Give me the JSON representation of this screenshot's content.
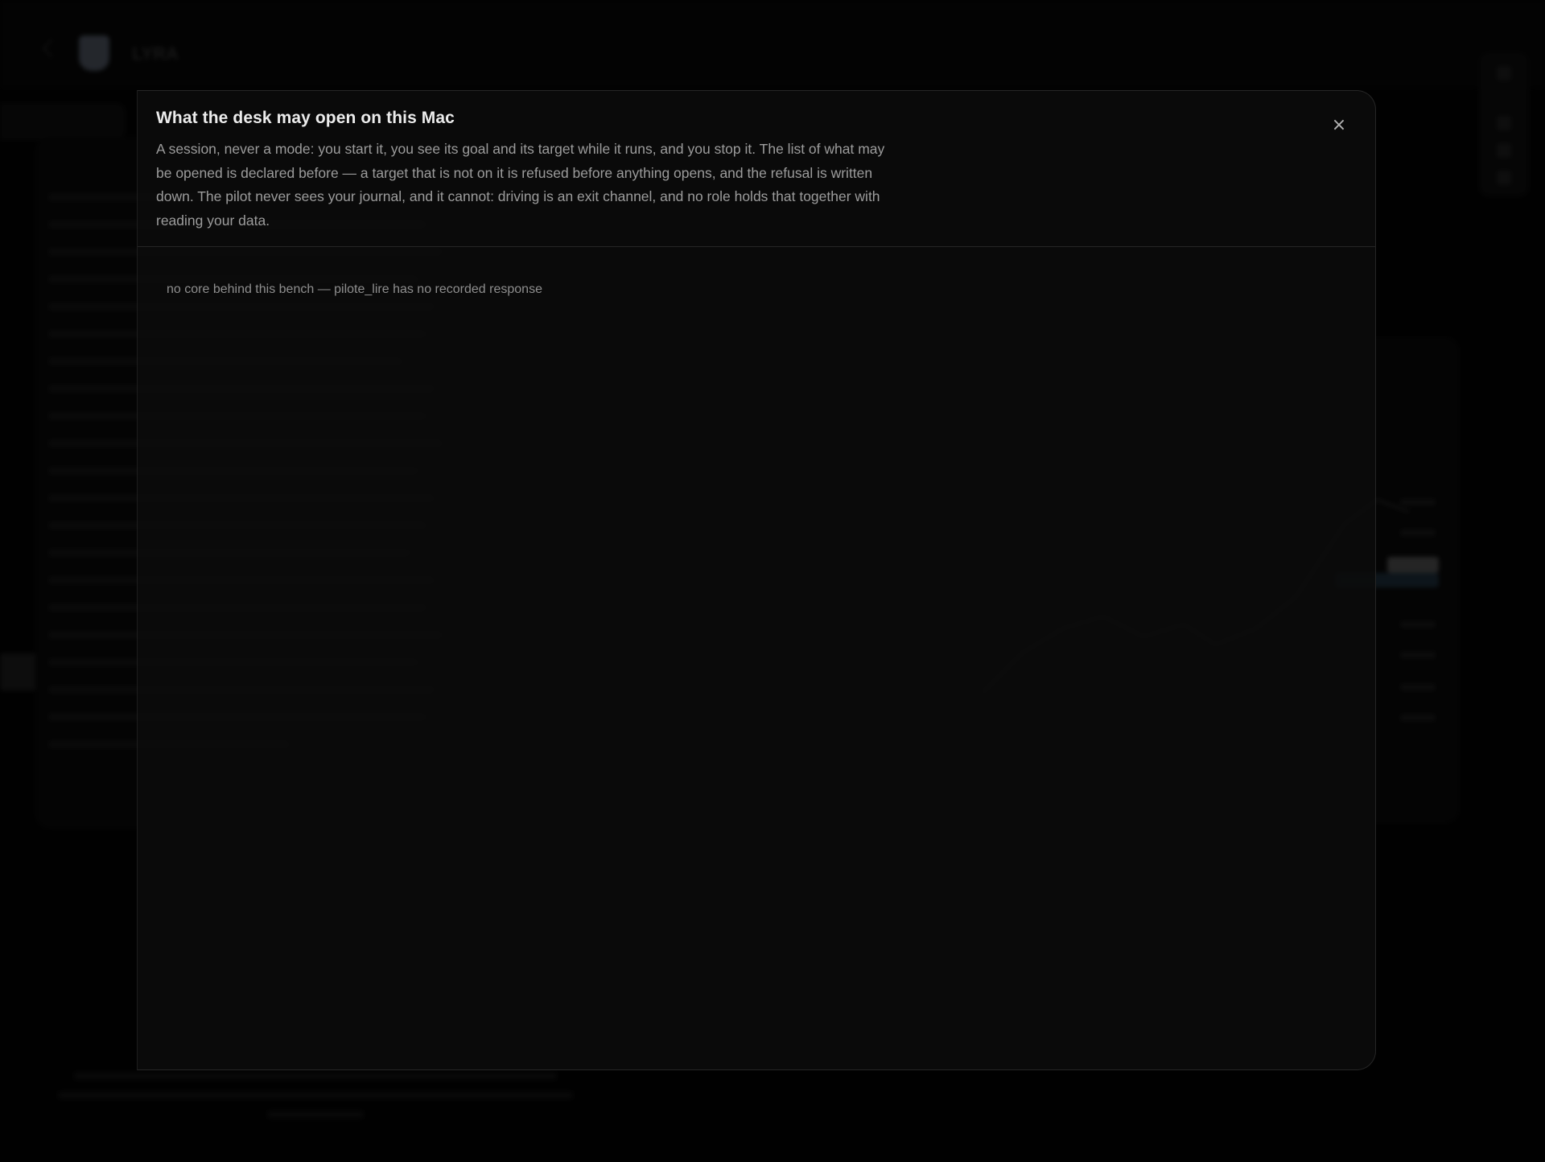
{
  "background": {
    "brand": "LYRA"
  },
  "modal": {
    "title": "What the desk may open on this Mac",
    "description": "A session, never a mode: you start it, you see its goal and its target while it runs, and you stop it. The list of what may be opened is declared before — a target that is not on it is refused before anything opens, and the refusal is written down. The pilot never sees your journal, and it cannot: driving is an exit channel, and no role holds that together with reading your data.",
    "close_icon": "close-icon",
    "close_glyph": "×",
    "empty_message": "no core behind this bench — pilote_lire has no recorded response"
  }
}
